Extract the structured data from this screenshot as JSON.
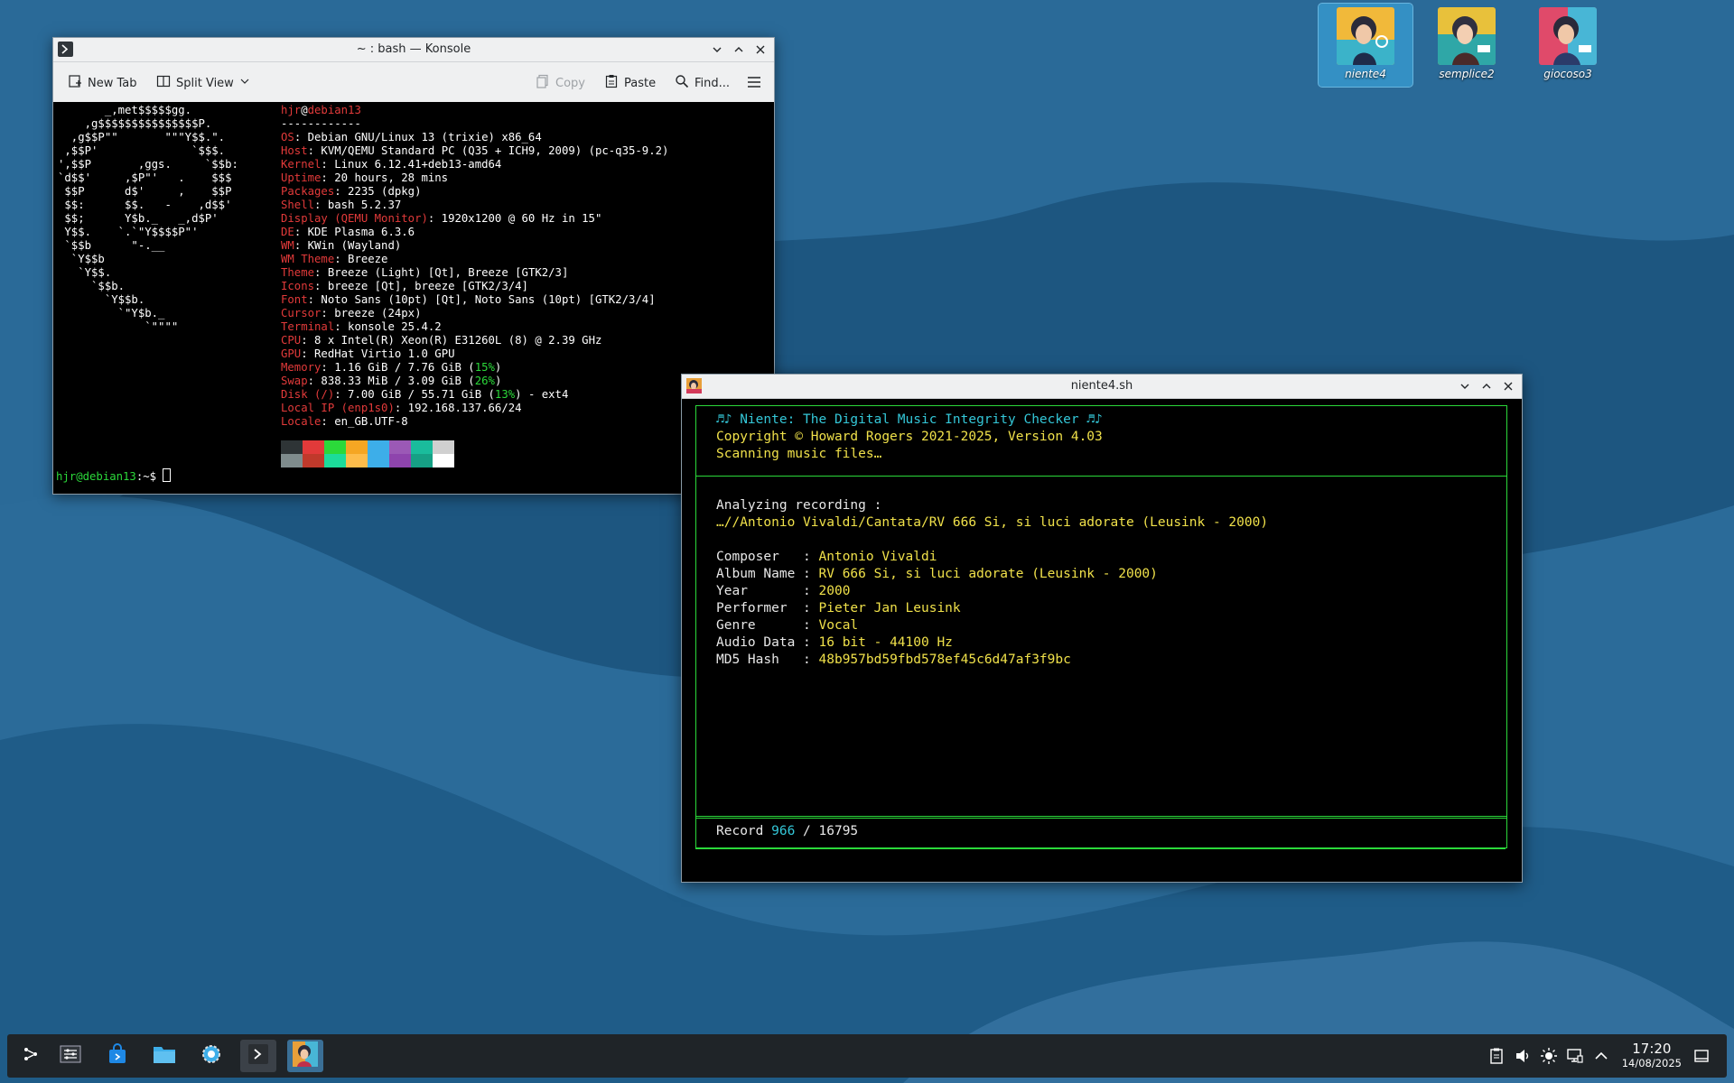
{
  "desktop": {
    "icons": [
      {
        "label": "niente4",
        "selected": true
      },
      {
        "label": "semplice2",
        "selected": false
      },
      {
        "label": "giocoso3",
        "selected": false
      }
    ]
  },
  "konsole": {
    "title": "~ : bash — Konsole",
    "toolbar": {
      "new_tab": "New Tab",
      "split_view": "Split View",
      "copy": "Copy",
      "paste": "Paste",
      "find": "Find..."
    },
    "logo_lines": [
      "       _,met$$$$$gg.",
      "    ,g$$$$$$$$$$$$$$$P.",
      "  ,g$$P\"\"       \"\"\"Y$$.\".",
      " ,$$P'              `$$$.",
      "',$$P       ,ggs.     `$$b:",
      "`d$$'     ,$P\"'   .    $$$",
      " $$P      d$'     ,    $$P",
      " $$:      $$.   -    ,d$$'",
      " $$;      Y$b._   _,d$P'",
      " Y$$.    `.`\"Y$$$$P\"'",
      " `$$b      \"-.__",
      "  `Y$$b",
      "   `Y$$.",
      "     `$$b.",
      "       `Y$$b.",
      "         `\"Y$b._",
      "             `\"\"\"\""
    ],
    "user": "hjr",
    "host": "debian13",
    "separator": "------------",
    "info": [
      {
        "key": "OS",
        "value": "Debian GNU/Linux 13 (trixie) x86_64"
      },
      {
        "key": "Host",
        "value": "KVM/QEMU Standard PC (Q35 + ICH9, 2009) (pc-q35-9.2)"
      },
      {
        "key": "Kernel",
        "value": "Linux 6.12.41+deb13-amd64"
      },
      {
        "key": "Uptime",
        "value": "20 hours, 28 mins"
      },
      {
        "key": "Packages",
        "value": "2235 (dpkg)"
      },
      {
        "key": "Shell",
        "value": "bash 5.2.37"
      },
      {
        "key": "Display (QEMU Monitor)",
        "value": "1920x1200 @ 60 Hz in 15\""
      },
      {
        "key": "DE",
        "value": "KDE Plasma 6.3.6"
      },
      {
        "key": "WM",
        "value": "KWin (Wayland)"
      },
      {
        "key": "WM Theme",
        "value": "Breeze"
      },
      {
        "key": "Theme",
        "value": "Breeze (Light) [Qt], Breeze [GTK2/3]"
      },
      {
        "key": "Icons",
        "value": "breeze [Qt], breeze [GTK2/3/4]"
      },
      {
        "key": "Font",
        "value": "Noto Sans (10pt) [Qt], Noto Sans (10pt) [GTK2/3/4]"
      },
      {
        "key": "Cursor",
        "value": "breeze (24px)"
      },
      {
        "key": "Terminal",
        "value": "konsole 25.4.2"
      },
      {
        "key": "CPU",
        "value": "8 x Intel(R) Xeon(R) E31260L (8) @ 2.39 GHz"
      },
      {
        "key": "GPU",
        "value": "RedHat Virtio 1.0 GPU"
      },
      {
        "key": "Memory",
        "value": "1.16 GiB / 7.76 GiB (",
        "pct": "15%",
        "tail": ")"
      },
      {
        "key": "Swap",
        "value": "838.33 MiB / 3.09 GiB (",
        "pct": "26%",
        "tail": ")"
      },
      {
        "key": "Disk (/)",
        "value": "7.00 GiB / 55.71 GiB (",
        "pct": "13%",
        "tail": ") - ext4"
      },
      {
        "key": "Local IP (enp1s0)",
        "value": "192.168.137.66/24"
      },
      {
        "key": "Locale",
        "value": "en_GB.UTF-8"
      }
    ],
    "palette": [
      "#2e3436",
      "#e23a3a",
      "#2bd93a",
      "#f5a623",
      "#3daee9",
      "#9b59b6",
      "#1abc9c",
      "#d0d0d0",
      "#7f8c8d",
      "#c0392b",
      "#1cdc9a",
      "#fdbc4b",
      "#3daee9",
      "#8e44ad",
      "#16a085",
      "#ffffff"
    ],
    "prompt_user_host": "hjr@debian13",
    "prompt_tail": ":~$ "
  },
  "niente": {
    "title": "niente4.sh",
    "header_line1": "♬♪ Niente: The Digital Music Integrity Checker ♬♪",
    "header_line2": "Copyright © Howard Rogers 2021-2025, Version 4.03",
    "header_line3": "Scanning music files…",
    "analyzing_label": "Analyzing recording :",
    "path": "…//Antonio Vivaldi/Cantata/RV 666 Si, si luci adorate (Leusink - 2000)",
    "fields": [
      {
        "label": "Composer   : ",
        "value": "Antonio Vivaldi"
      },
      {
        "label": "Album Name : ",
        "value": "RV 666 Si, si luci adorate (Leusink - 2000)"
      },
      {
        "label": "Year       : ",
        "value": "2000"
      },
      {
        "label": "Performer  : ",
        "value": "Pieter Jan Leusink"
      },
      {
        "label": "Genre      : ",
        "value": "Vocal"
      },
      {
        "label": "Audio Data : ",
        "value": "16 bit - 44100 Hz"
      },
      {
        "label": "MD5 Hash   : ",
        "value": "48b957bd59fbd578ef45c6d47af3f9bc"
      }
    ],
    "record_label": "Record ",
    "record_current": "966",
    "record_sep": " / ",
    "record_total": "16795"
  },
  "taskbar": {
    "time": "17:20",
    "date": "14/08/2025"
  }
}
